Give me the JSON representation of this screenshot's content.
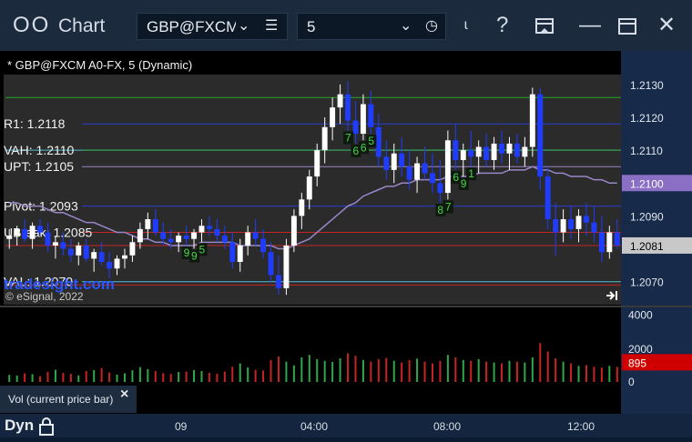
{
  "window": {
    "title": "Chart",
    "symbol": "GBP@FXCM",
    "interval": "5",
    "icons": [
      "chart-logo-icon",
      "chevron-down-icon",
      "menu-icon",
      "clock-icon",
      "pin-icon",
      "help-icon",
      "template-icon",
      "maximize-icon",
      "close-icon"
    ]
  },
  "chart": {
    "header": "* GBP@FXCM A0-FX, 5 (Dynamic)",
    "watermark": "tradesight.com",
    "copyright": "© eSignal, 2022",
    "price_axis_ticks": [
      "1.2130",
      "1.2120",
      "1.2110",
      "1.2100",
      "1.2090",
      "1.2081",
      "1.2070"
    ],
    "last_price": "1.2081",
    "ma_value": "1.2100",
    "volume_axis_ticks": [
      "4000",
      "2000",
      "0"
    ],
    "last_volume": "895",
    "volume_panel_label": "Vol (current price bar)",
    "time_labels": [
      "09",
      "04:00",
      "08:00",
      "12:00"
    ],
    "bottom_label": "Dyn",
    "numbers_on_chart": [
      "9",
      "9",
      "5",
      "7",
      "6",
      "6",
      "5",
      "8",
      "7",
      "6",
      "9",
      "1"
    ]
  },
  "chart_data": {
    "type": "candlestick",
    "price_range": [
      1.2063,
      1.2133
    ],
    "levels": [
      {
        "label": "R1: 1.2118",
        "value": 1.2118,
        "color": "#2b3dd1"
      },
      {
        "label": "VAH: 1.2110",
        "value": 1.211,
        "color": "#2ea84b"
      },
      {
        "label": "UPT: 1.2105",
        "value": 1.2105,
        "color": "#9a86c7"
      },
      {
        "label": "Pivot: 1.2093",
        "value": 1.2093,
        "color": "#2b3dd1"
      },
      {
        "label": "UBreak: 1.2085",
        "value": 1.2085,
        "color": "#c62424"
      },
      {
        "label": "VAL: 1.2070",
        "value": 1.207,
        "color": "#4fbfd1"
      }
    ],
    "extra_lines": [
      {
        "value": 1.2126,
        "color": "#27a827"
      },
      {
        "value": 1.211,
        "color": "#4fbfd1"
      },
      {
        "value": 1.2069,
        "color": "#c62424"
      },
      {
        "value": 1.2081,
        "color": "#c62424"
      }
    ],
    "ohlc": [
      [
        1.2083,
        1.2086,
        1.208,
        1.2084
      ],
      [
        1.2084,
        1.2087,
        1.2081,
        1.2086
      ],
      [
        1.2086,
        1.2089,
        1.2082,
        1.2083
      ],
      [
        1.2083,
        1.2088,
        1.208,
        1.2087
      ],
      [
        1.2087,
        1.2089,
        1.2084,
        1.2085
      ],
      [
        1.2085,
        1.2088,
        1.2079,
        1.2081
      ],
      [
        1.2081,
        1.2084,
        1.2077,
        1.2082
      ],
      [
        1.2082,
        1.2085,
        1.2078,
        1.208
      ],
      [
        1.208,
        1.2083,
        1.2076,
        1.2078
      ],
      [
        1.2078,
        1.2082,
        1.2075,
        1.2081
      ],
      [
        1.2081,
        1.2083,
        1.2076,
        1.2077
      ],
      [
        1.2077,
        1.208,
        1.2073,
        1.2079
      ],
      [
        1.2079,
        1.2082,
        1.2075,
        1.2076
      ],
      [
        1.2076,
        1.2079,
        1.2071,
        1.2074
      ],
      [
        1.2074,
        1.2078,
        1.2072,
        1.2077
      ],
      [
        1.2077,
        1.208,
        1.2074,
        1.2078
      ],
      [
        1.2078,
        1.2084,
        1.2076,
        1.2082
      ],
      [
        1.2082,
        1.2088,
        1.208,
        1.2086
      ],
      [
        1.2086,
        1.2091,
        1.2083,
        1.2089
      ],
      [
        1.2089,
        1.2092,
        1.2084,
        1.2085
      ],
      [
        1.2085,
        1.2088,
        1.2081,
        1.2083
      ],
      [
        1.2083,
        1.2086,
        1.208,
        1.2082
      ],
      [
        1.2082,
        1.2085,
        1.2079,
        1.2084
      ],
      [
        1.2084,
        1.2087,
        1.2081,
        1.2083
      ],
      [
        1.2083,
        1.2086,
        1.208,
        1.2085
      ],
      [
        1.2085,
        1.2089,
        1.2082,
        1.2087
      ],
      [
        1.2087,
        1.209,
        1.2084,
        1.2086
      ],
      [
        1.2086,
        1.2089,
        1.2082,
        1.2084
      ],
      [
        1.2084,
        1.2087,
        1.208,
        1.2082
      ],
      [
        1.2082,
        1.2085,
        1.2074,
        1.2076
      ],
      [
        1.2076,
        1.2083,
        1.2073,
        1.2081
      ],
      [
        1.2081,
        1.2087,
        1.2078,
        1.2085
      ],
      [
        1.2085,
        1.2089,
        1.2081,
        1.2083
      ],
      [
        1.2083,
        1.2086,
        1.2077,
        1.2079
      ],
      [
        1.2079,
        1.2082,
        1.207,
        1.2072
      ],
      [
        1.2072,
        1.2078,
        1.2066,
        1.2068
      ],
      [
        1.2068,
        1.2083,
        1.2066,
        1.2081
      ],
      [
        1.2081,
        1.2092,
        1.2079,
        1.209
      ],
      [
        1.209,
        1.2097,
        1.2086,
        1.2095
      ],
      [
        1.2095,
        1.2104,
        1.2092,
        1.2102
      ],
      [
        1.2102,
        1.2112,
        1.2099,
        1.211
      ],
      [
        1.211,
        1.212,
        1.2106,
        1.2117
      ],
      [
        1.2117,
        1.2126,
        1.2113,
        1.2123
      ],
      [
        1.2123,
        1.213,
        1.2118,
        1.2127
      ],
      [
        1.2127,
        1.2131,
        1.2116,
        1.2119
      ],
      [
        1.2119,
        1.2125,
        1.2112,
        1.2115
      ],
      [
        1.2115,
        1.2127,
        1.2113,
        1.2124
      ],
      [
        1.2124,
        1.2128,
        1.2115,
        1.2117
      ],
      [
        1.2117,
        1.2121,
        1.2105,
        1.2108
      ],
      [
        1.2108,
        1.2113,
        1.2101,
        1.2104
      ],
      [
        1.2104,
        1.2112,
        1.21,
        1.2109
      ],
      [
        1.2109,
        1.2114,
        1.2102,
        1.2105
      ],
      [
        1.2105,
        1.211,
        1.2098,
        1.2101
      ],
      [
        1.2101,
        1.2108,
        1.2097,
        1.2106
      ],
      [
        1.2106,
        1.2111,
        1.2101,
        1.2103
      ],
      [
        1.2103,
        1.2109,
        1.2097,
        1.21
      ],
      [
        1.21,
        1.2107,
        1.2094,
        1.2097
      ],
      [
        1.2097,
        1.2116,
        1.2095,
        1.2113
      ],
      [
        1.2113,
        1.2118,
        1.2104,
        1.2107
      ],
      [
        1.2107,
        1.2112,
        1.2102,
        1.211
      ],
      [
        1.211,
        1.2116,
        1.2105,
        1.2108
      ],
      [
        1.2108,
        1.2113,
        1.2103,
        1.2111
      ],
      [
        1.2111,
        1.2115,
        1.2105,
        1.2107
      ],
      [
        1.2107,
        1.2114,
        1.2104,
        1.2112
      ],
      [
        1.2112,
        1.2116,
        1.2106,
        1.2109
      ],
      [
        1.2109,
        1.2114,
        1.2104,
        1.2112
      ],
      [
        1.2112,
        1.2115,
        1.2106,
        1.2108
      ],
      [
        1.2108,
        1.2114,
        1.2105,
        1.2111
      ],
      [
        1.2111,
        1.2129,
        1.2108,
        1.2127
      ],
      [
        1.2127,
        1.2129,
        1.2098,
        1.2102
      ],
      [
        1.2102,
        1.2105,
        1.2086,
        1.2089
      ],
      [
        1.2089,
        1.2094,
        1.2078,
        1.2085
      ],
      [
        1.2085,
        1.2092,
        1.2082,
        1.2089
      ],
      [
        1.2089,
        1.2093,
        1.2083,
        1.2086
      ],
      [
        1.2086,
        1.2092,
        1.2082,
        1.209
      ],
      [
        1.209,
        1.2094,
        1.2084,
        1.2088
      ],
      [
        1.2088,
        1.2093,
        1.2082,
        1.2085
      ],
      [
        1.2085,
        1.209,
        1.2076,
        1.2079
      ],
      [
        1.2079,
        1.2087,
        1.2077,
        1.2085
      ],
      [
        1.2085,
        1.2089,
        1.208,
        1.2081
      ]
    ],
    "moving_average": [
      1.2094,
      1.2094,
      1.2093,
      1.2093,
      1.2093,
      1.2092,
      1.2091,
      1.2091,
      1.209,
      1.2089,
      1.2088,
      1.2088,
      1.2087,
      1.2086,
      1.2085,
      1.2085,
      1.2084,
      1.2083,
      1.2083,
      1.2082,
      1.2082,
      1.2081,
      1.2081,
      1.2081,
      1.2081,
      1.2082,
      1.2082,
      1.2082,
      1.2082,
      1.2082,
      1.2081,
      1.2081,
      1.2081,
      1.2081,
      1.2081,
      1.208,
      1.208,
      1.2081,
      1.2082,
      1.2083,
      1.2085,
      1.2087,
      1.2089,
      1.2091,
      1.2093,
      1.2094,
      1.2096,
      1.2097,
      1.2098,
      1.2099,
      1.2099,
      1.21,
      1.21,
      1.2101,
      1.2101,
      1.2101,
      1.2101,
      1.2102,
      1.2102,
      1.2102,
      1.2102,
      1.2103,
      1.2103,
      1.2103,
      1.2103,
      1.2104,
      1.2104,
      1.2104,
      1.2105,
      1.2104,
      1.2104,
      1.2103,
      1.2103,
      1.2102,
      1.2102,
      1.2102,
      1.2101,
      1.2101,
      1.21,
      1.21
    ],
    "volume": [
      420,
      380,
      510,
      460,
      350,
      600,
      720,
      540,
      480,
      390,
      650,
      700,
      820,
      560,
      430,
      510,
      690,
      880,
      760,
      640,
      520,
      470,
      590,
      610,
      700,
      650,
      540,
      480,
      610,
      900,
      1100,
      860,
      720,
      680,
      1300,
      1500,
      1200,
      980,
      1450,
      1600,
      1350,
      1250,
      1180,
      1400,
      1700,
      1550,
      1300,
      1200,
      1350,
      1420,
      1250,
      1150,
      1300,
      1380,
      1200,
      1100,
      1250,
      1600,
      1450,
      1300,
      1250,
      1350,
      1200,
      1150,
      1100,
      1250,
      1200,
      1150,
      1450,
      2300,
      1800,
      1400,
      1200,
      1100,
      950,
      1000,
      900,
      850,
      950,
      895
    ],
    "volume_range": [
      0,
      4300
    ],
    "time_axis": [
      "09",
      "04:00",
      "08:00",
      "12:00"
    ]
  }
}
